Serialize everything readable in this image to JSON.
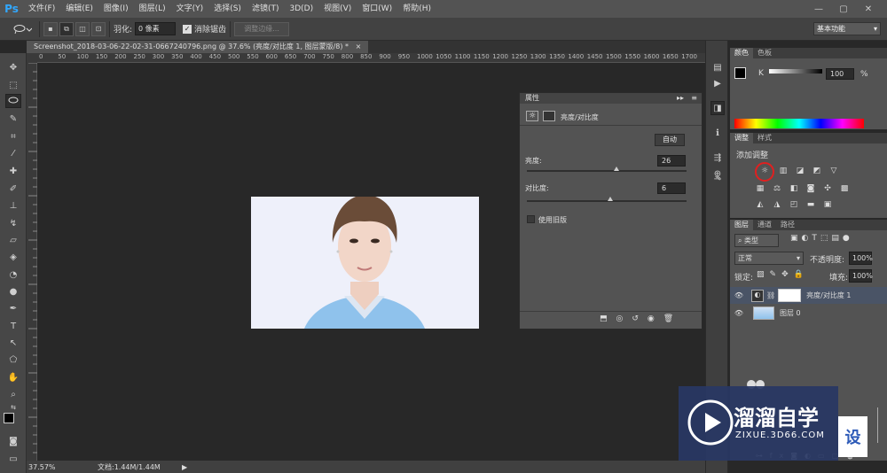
{
  "app": {
    "logo": "Ps"
  },
  "menu": [
    "文件(F)",
    "编辑(E)",
    "图像(I)",
    "图层(L)",
    "文字(Y)",
    "选择(S)",
    "滤镜(T)",
    "3D(D)",
    "视图(V)",
    "窗口(W)",
    "帮助(H)"
  ],
  "window_controls": [
    "—",
    "▢",
    "✕"
  ],
  "options": {
    "feather_label": "羽化:",
    "feather_value": "0 像素",
    "antialias_label": "消除锯齿",
    "refine_edge": "调整边缘...",
    "workspace": "基本功能"
  },
  "document": {
    "tab_title": "Screenshot_2018-03-06-22-02-31-0667240796.png @ 37.6% (亮度/对比度 1, 图层蒙版/8) *",
    "zoom": "37.57%",
    "doc_size": "文档:1.44M/1.44M"
  },
  "ruler_labels": [
    "0",
    "50",
    "100",
    "150",
    "200",
    "250",
    "300",
    "350",
    "400",
    "450",
    "500",
    "550",
    "600",
    "650",
    "700",
    "750",
    "800",
    "850",
    "900",
    "950",
    "1000",
    "1050",
    "1100",
    "1150",
    "1200",
    "1250",
    "1300",
    "1350",
    "1400",
    "1450",
    "1500",
    "1550",
    "1600",
    "1650",
    "1700"
  ],
  "properties": {
    "panel_title": "属性",
    "adjust_title": "亮度/对比度",
    "auto_label": "自动",
    "brightness_label": "亮度:",
    "brightness_value": "26",
    "brightness_level": 0.56,
    "contrast_label": "对比度:",
    "contrast_value": "6",
    "contrast_level": 0.52,
    "legacy_label": "使用旧版"
  },
  "color_panel": {
    "tabs": [
      "颜色",
      "色板"
    ],
    "channel": "K",
    "value": "100",
    "unit": "%"
  },
  "adjust_panel": {
    "tabs": [
      "调整",
      "样式"
    ],
    "heading": "添加调整"
  },
  "layers_panel": {
    "tabs": [
      "图层",
      "通道",
      "路径"
    ],
    "kind": "类型",
    "blend": "正常",
    "opacity_label": "不透明度:",
    "opacity_value": "100%",
    "lock_label": "锁定:",
    "fill_label": "填充:",
    "fill_value": "100%",
    "layers": [
      {
        "name": "亮度/对比度 1"
      },
      {
        "name": "图层 0"
      }
    ]
  },
  "watermark": {
    "brand": "溜溜自学",
    "url": "ZIXUE.3D66.COM",
    "side": "设"
  },
  "colors": {
    "accent": "#31a8ff",
    "highlight_ring": "#e02020"
  }
}
